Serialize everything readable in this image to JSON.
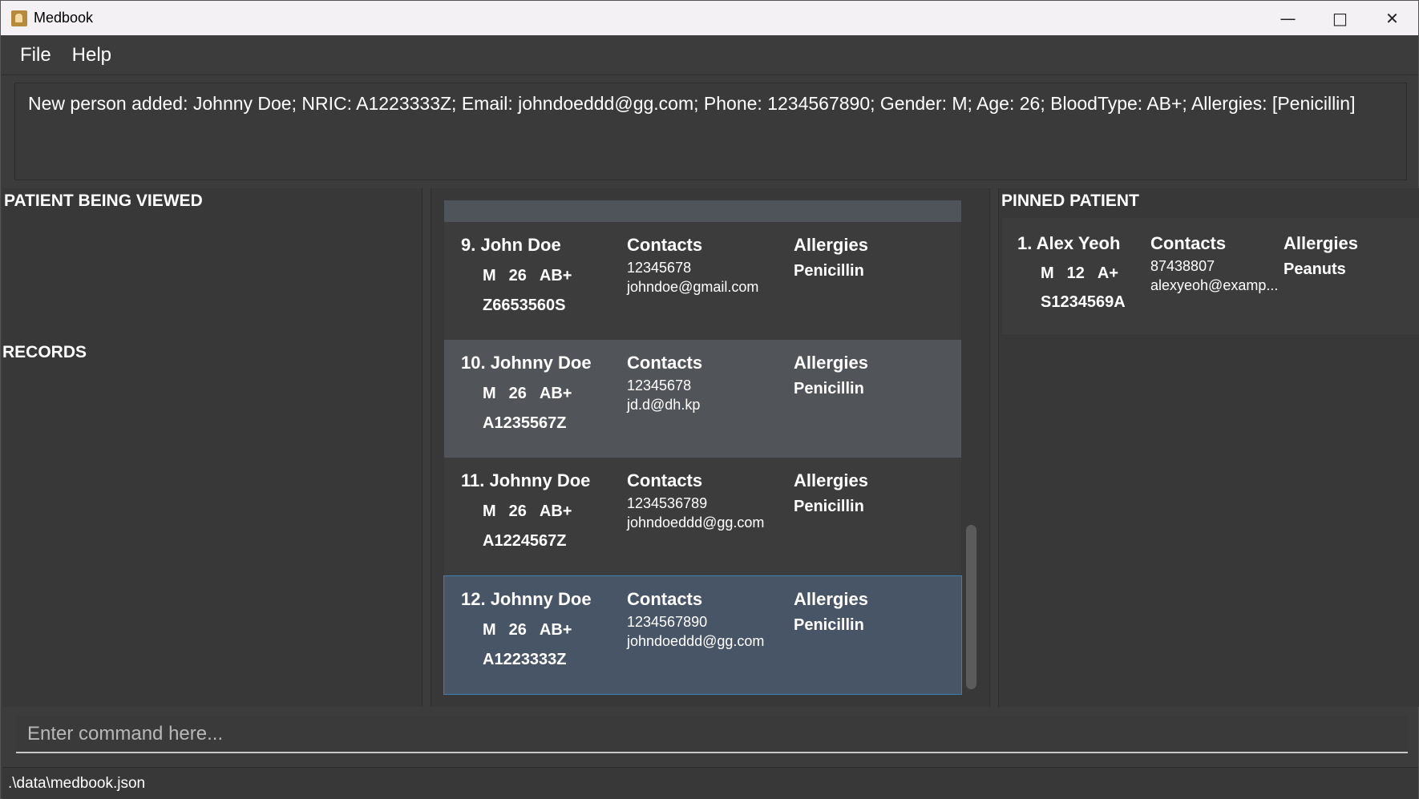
{
  "window": {
    "title": "Medbook",
    "minimize_icon": "minimize-icon",
    "maximize_icon": "maximize-icon",
    "close_icon": "close-icon"
  },
  "menu": {
    "items": [
      "File",
      "Help"
    ]
  },
  "result": {
    "text": "New person added: Johnny Doe; NRIC: A1223333Z; Email: johndoeddd@gg.com; Phone: 1234567890; Gender: M; Age: 26; BloodType: AB+; Allergies: [Penicillin]"
  },
  "left": {
    "viewing_heading": "PATIENT BEING VIEWED",
    "records_heading": "RECORDS"
  },
  "patients": [
    {
      "name": "9. John Doe",
      "gender": "M",
      "age": "26",
      "blood": "AB+",
      "nric": "Z6653560S",
      "contacts_label": "Contacts",
      "phone": "12345678",
      "email": "johndoe@gmail.com",
      "allergies_label": "Allergies",
      "allergy": "Penicillin"
    },
    {
      "name": "10. Johnny Doe",
      "gender": "M",
      "age": "26",
      "blood": "AB+",
      "nric": "A1235567Z",
      "contacts_label": "Contacts",
      "phone": "12345678",
      "email": "jd.d@dh.kp",
      "allergies_label": "Allergies",
      "allergy": "Penicillin"
    },
    {
      "name": "11. Johnny Doe",
      "gender": "M",
      "age": "26",
      "blood": "AB+",
      "nric": "A1224567Z",
      "contacts_label": "Contacts",
      "phone": "1234536789",
      "email": "johndoeddd@gg.com",
      "allergies_label": "Allergies",
      "allergy": "Penicillin"
    },
    {
      "name": "12. Johnny Doe",
      "gender": "M",
      "age": "26",
      "blood": "AB+",
      "nric": "A1223333Z",
      "contacts_label": "Contacts",
      "phone": "1234567890",
      "email": "johndoeddd@gg.com",
      "allergies_label": "Allergies",
      "allergy": "Penicillin"
    }
  ],
  "pinned": {
    "heading": "PINNED PATIENT",
    "patient": {
      "name": "1. Alex Yeoh",
      "gender": "M",
      "age": "12",
      "blood": "A+",
      "nric": "S1234569A",
      "contacts_label": "Contacts",
      "phone": "87438807",
      "email": "alexyeoh@examp...",
      "allergies_label": "Allergies",
      "allergy": "Peanuts"
    }
  },
  "command": {
    "placeholder": "Enter command here..."
  },
  "status": {
    "path": ".\\data\\medbook.json"
  }
}
